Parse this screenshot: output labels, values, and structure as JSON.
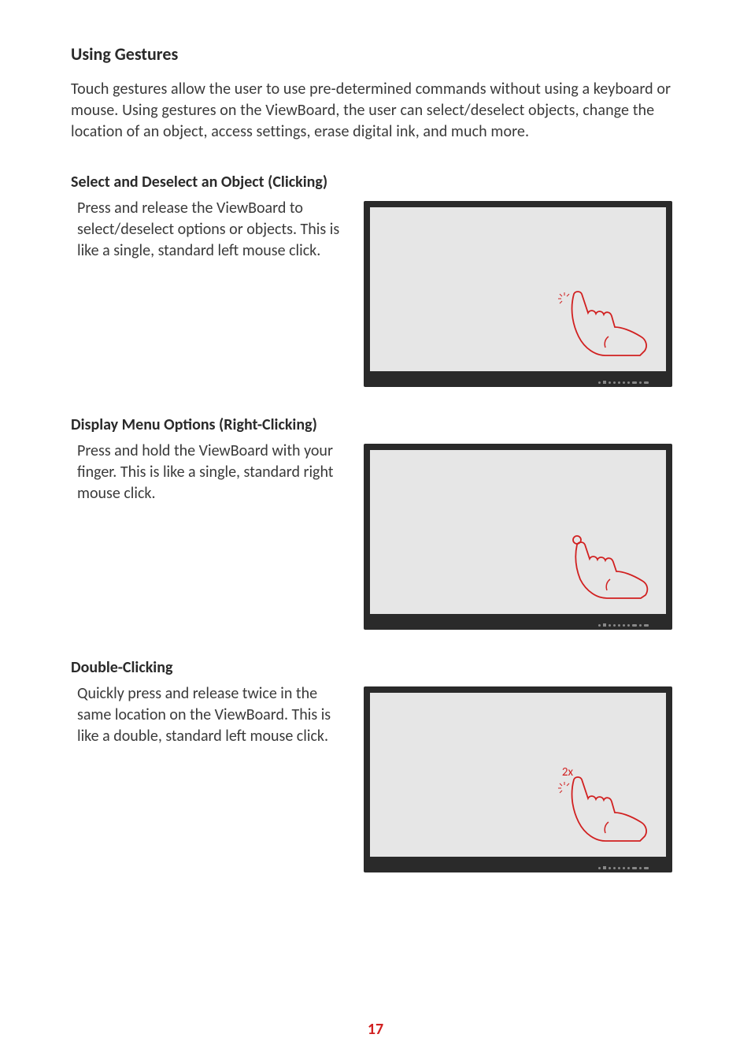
{
  "heading_main": "Using Gestures",
  "intro": "Touch gestures allow the user to use pre-determined commands without using a keyboard or mouse. Using gestures on the ViewBoard, the user can select/deselect objects, change the location of an object, access settings, erase digital ink, and much more.",
  "sections": [
    {
      "heading": "Select and Deselect an Object (Clicking)",
      "body": "Press and release the ViewBoard to select/deselect options or objects. This is like a single, standard left mouse click.",
      "overlay": ""
    },
    {
      "heading": "Display Menu Options (Right-Clicking)",
      "body": "Press and hold the ViewBoard with your finger. This is like a single, standard right mouse click.",
      "overlay": ""
    },
    {
      "heading": "Double-Clicking",
      "body": "Quickly press and release twice in the same location on the ViewBoard. This is like a double, standard left mouse click.",
      "overlay": "2x"
    }
  ],
  "page_number": "17"
}
